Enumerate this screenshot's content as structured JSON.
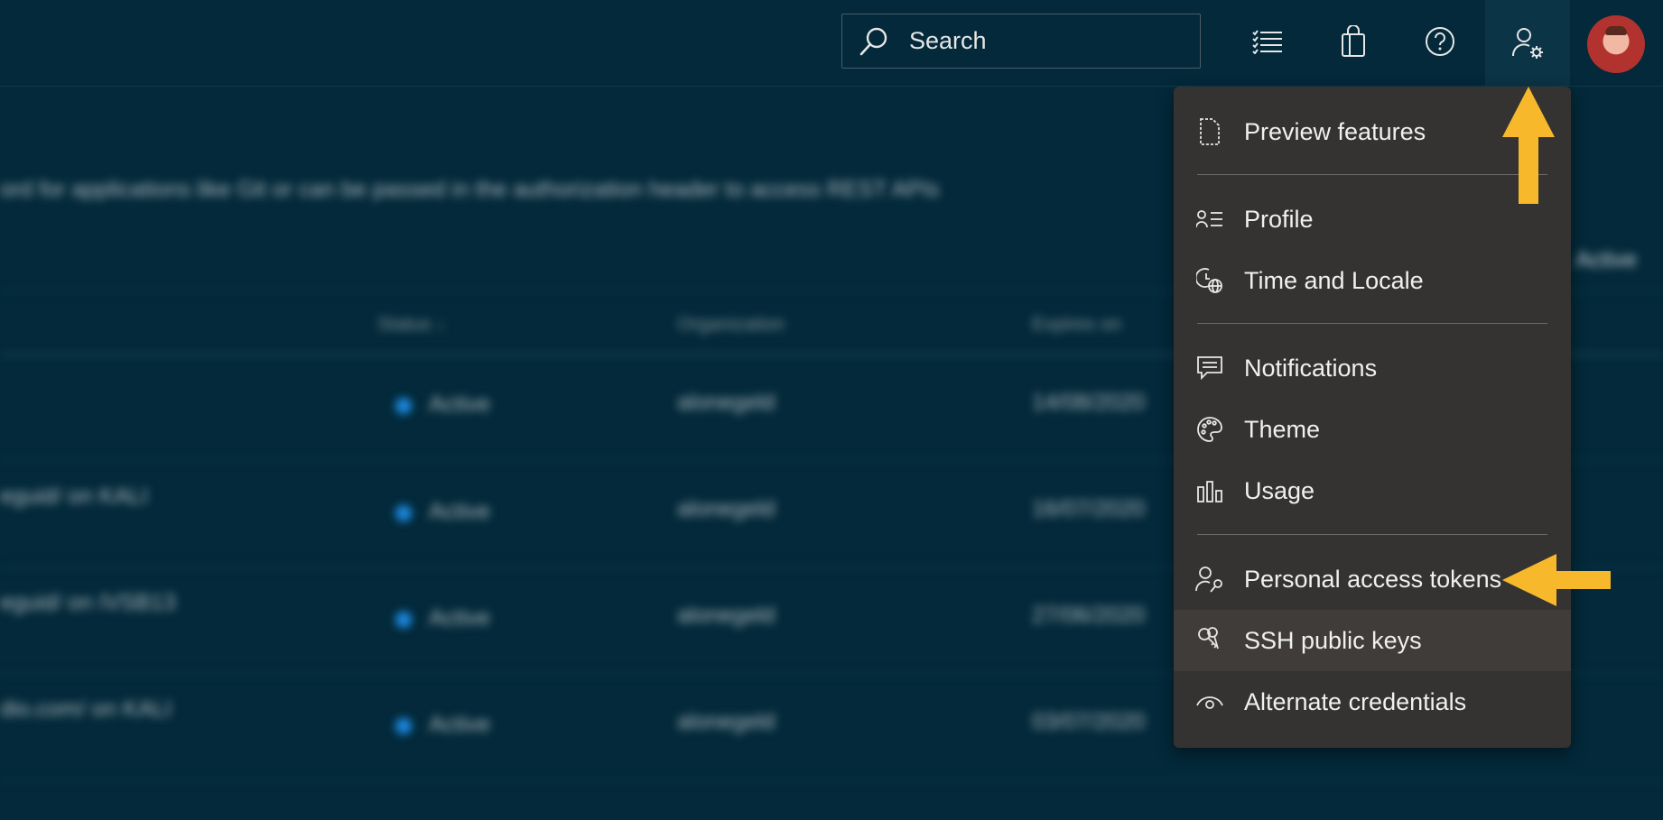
{
  "search": {
    "placeholder": "Search",
    "icon": "search-icon"
  },
  "topbar": {
    "icons": [
      "list-icon",
      "shopping-bag-icon",
      "help-icon",
      "user-settings-icon"
    ],
    "avatar": "avatar"
  },
  "background": {
    "description_text": "ord for applications like Git or can be passed in the authorization header to access REST APIs",
    "filter_label": "Active",
    "columns": [
      "Status ↓",
      "Organization",
      "Expires on"
    ],
    "rows": [
      {
        "name": "",
        "status": "Active",
        "org": "alonegeld",
        "expires": "14/08/2020"
      },
      {
        "name": "eguid/ on KALI",
        "status": "Active",
        "org": "alonegeld",
        "expires": "16/07/2020"
      },
      {
        "name": "eguid/ on IVSB13",
        "status": "Active",
        "org": "alonegeld",
        "expires": "27/06/2020"
      },
      {
        "name": "dio.com/ on KALI",
        "status": "Active",
        "org": "alonegeld",
        "expires": "03/07/2020"
      }
    ]
  },
  "menu": {
    "items": [
      {
        "label": "Preview features",
        "icon": "page-icon"
      },
      {
        "label": "Profile",
        "icon": "profile-list-icon"
      },
      {
        "label": "Time and Locale",
        "icon": "clock-globe-icon"
      },
      {
        "label": "Notifications",
        "icon": "chat-icon"
      },
      {
        "label": "Theme",
        "icon": "palette-icon"
      },
      {
        "label": "Usage",
        "icon": "bar-chart-icon"
      },
      {
        "label": "Personal access tokens",
        "icon": "user-key-icon"
      },
      {
        "label": "SSH public keys",
        "icon": "keys-icon"
      },
      {
        "label": "Alternate credentials",
        "icon": "eye-icon"
      }
    ]
  },
  "colors": {
    "background": "#03293a",
    "menu": "#353331",
    "highlight_arrow": "#f7b92b"
  }
}
